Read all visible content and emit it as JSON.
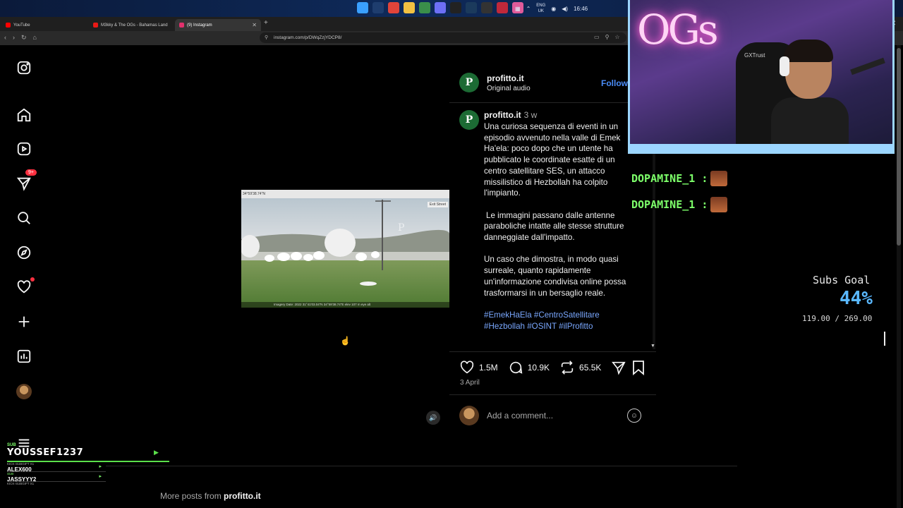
{
  "browser": {
    "tabs": [
      {
        "label": "YouTube",
        "color": "#ff0000"
      },
      {
        "label": "M3kky & The OGs - Bahamas Land",
        "color": "#e91916"
      },
      {
        "label": "(9) Instagram",
        "color": "#e1306c"
      }
    ],
    "new_tab": "+",
    "url": "instagram.com/p/DWqZzjYDCP8/"
  },
  "taskbar": {
    "lang_line1": "ENG",
    "lang_line2": "UK",
    "time": "16:46"
  },
  "sidebar": {
    "notification_badge": "9+",
    "icons": [
      "instagram-logo-icon",
      "home-icon",
      "reels-icon",
      "messages-icon",
      "search-icon",
      "explore-icon",
      "heart-icon",
      "create-icon",
      "insights-icon",
      "profile-avatar",
      "menu-icon"
    ]
  },
  "post": {
    "image_toolbar_text": "34°59'38.74\"N",
    "image_exit_label": "Exit Street",
    "image_footer_text": "Imagery Date: 2022   31°41'03.04\"N   34°59'38.74\"E   elev   107 m   eye alt",
    "header": {
      "username": "profitto.it",
      "audio": "Original audio",
      "follow": "Follow"
    },
    "caption": {
      "username": "profitto.it",
      "age": "3 w",
      "paragraphs": [
        "Una curiosa sequenza di eventi in un episodio avvenuto nella valle di Emek Ha'ela: poco dopo che un utente ha pubblicato le coordinate esatte di un centro satellitare SES, un attacco missilistico di Hezbollah ha colpito l'impianto.",
        "Le immagini passano dalle antenne paraboliche intatte alle stesse strutture danneggiate dall'impatto.",
        "Un caso che dimostra, in modo quasi surreale, quanto rapidamente un'informazione condivisa online possa trasformarsi in un bersaglio reale."
      ],
      "hashtags": "#EmekHaEla #CentroSatellitare #Hezbollah #OSINT #ilProfitto"
    },
    "likes": "1.5M",
    "comments": "10.9K",
    "reposts": "65.5K",
    "date": "3 April",
    "comment_placeholder": "Add a comment...",
    "more_posts_prefix": "More posts from ",
    "more_posts_user": "profitto.it"
  },
  "stream": {
    "webcam_sign": "OGs",
    "chair_brand": "GXTrust",
    "chat": [
      {
        "name": "DOPAMINE_1 :"
      },
      {
        "name": "DOPAMINE_1 :"
      }
    ],
    "subs_goal": {
      "title": "Subs Goal",
      "percent": "44%",
      "count": "119.00 / 269.00",
      "progress": 0.44
    },
    "alerts": {
      "sub_label": "SUB",
      "main_user": "YOUSSEF1237",
      "kick_label": "KICK-SUBGIFT X1",
      "gift_user": "ALEX600",
      "sub_label_2": "SUB",
      "user_2": "JASSYYY2",
      "kick_label_2": "KICK-SUBGIFT X1"
    }
  }
}
